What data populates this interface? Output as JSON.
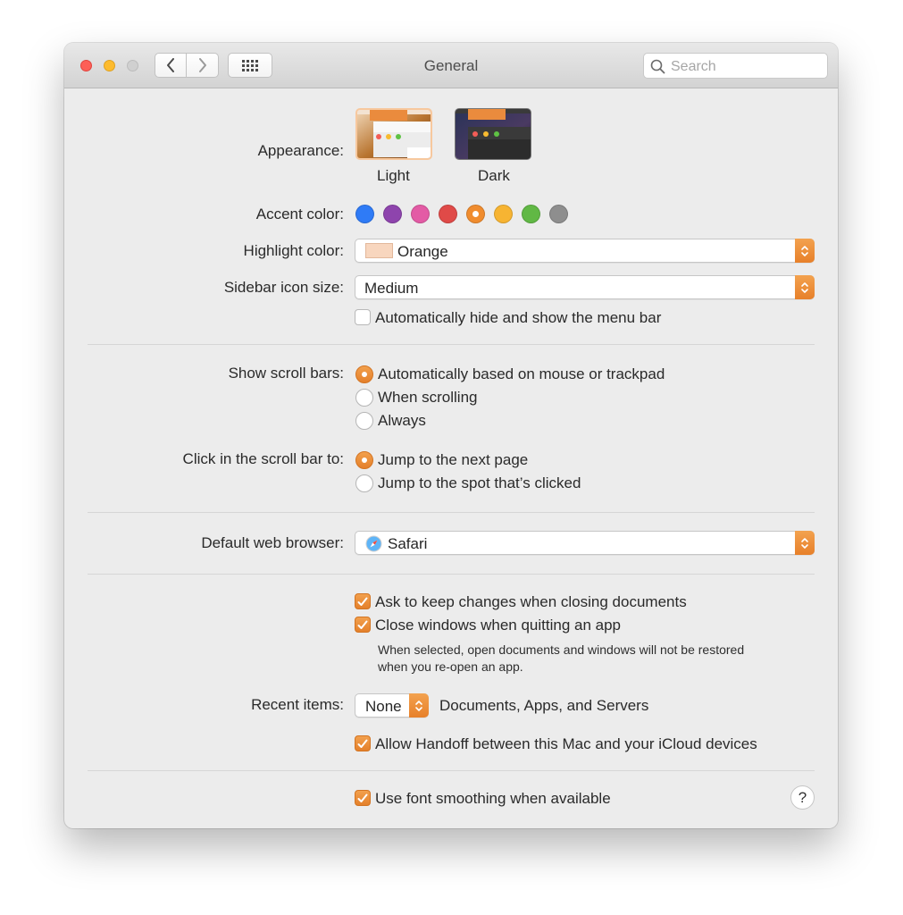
{
  "window": {
    "title": "General",
    "search_placeholder": "Search"
  },
  "icons": {
    "close": "traffic-light-close",
    "minimize": "traffic-light-minimize",
    "zoom": "traffic-light-zoom",
    "back": "chevron-left-icon",
    "forward": "chevron-right-icon",
    "grid": "grid-icon",
    "search": "magnifier-icon",
    "safari": "safari-compass-icon",
    "help": "question-mark"
  },
  "appearance": {
    "label": "Appearance:",
    "options": [
      {
        "name": "Light",
        "selected": true
      },
      {
        "name": "Dark",
        "selected": false
      }
    ]
  },
  "accent": {
    "label": "Accent color:",
    "colors": [
      "#2f7bf6",
      "#8e44ad",
      "#e35ba5",
      "#e04a48",
      "#f08c2e",
      "#f7b432",
      "#61b845",
      "#8e8e8e"
    ],
    "selected_index": 4
  },
  "highlight": {
    "label": "Highlight color:",
    "value": "Orange",
    "swatch_color": "#f8d6be"
  },
  "sidebar_icon_size": {
    "label": "Sidebar icon size:",
    "value": "Medium"
  },
  "menu_bar_autohide": {
    "label": "Automatically hide and show the menu bar",
    "checked": false
  },
  "scroll_bars": {
    "label": "Show scroll bars:",
    "options": [
      "Automatically based on mouse or trackpad",
      "When scrolling",
      "Always"
    ],
    "selected_index": 0
  },
  "scroll_click": {
    "label": "Click in the scroll bar to:",
    "options": [
      "Jump to the next page",
      "Jump to the spot that’s clicked"
    ],
    "selected_index": 0
  },
  "browser": {
    "label": "Default web browser:",
    "value": "Safari"
  },
  "documents": {
    "ask_keep_changes": {
      "label": "Ask to keep changes when closing documents",
      "checked": true
    },
    "close_windows": {
      "label": "Close windows when quitting an app",
      "checked": true
    },
    "note_line1": "When selected, open documents and windows will not be restored",
    "note_line2": "when you re-open an app."
  },
  "recent_items": {
    "label": "Recent items:",
    "value": "None",
    "suffix": "Documents, Apps, and Servers"
  },
  "handoff": {
    "label": "Allow Handoff between this Mac and your iCloud devices",
    "checked": true
  },
  "font_smoothing": {
    "label": "Use font smoothing when available",
    "checked": true
  },
  "help_glyph": "?",
  "colors": {
    "accent": "#e8852d",
    "window_bg": "#ececec"
  }
}
